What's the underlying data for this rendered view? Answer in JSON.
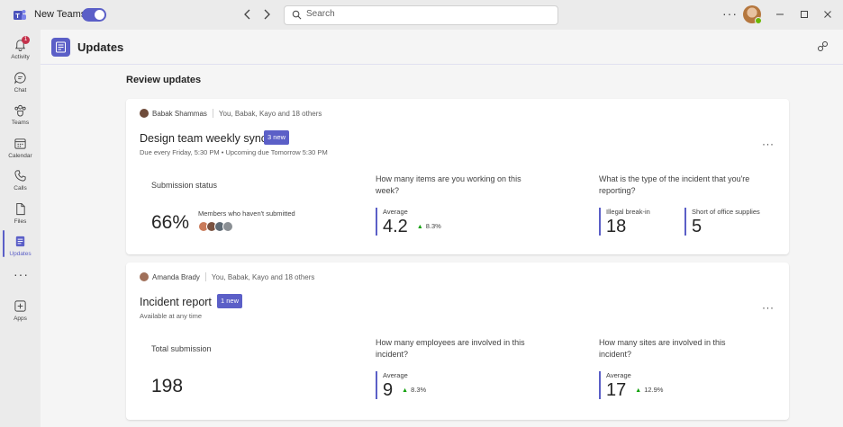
{
  "titlebar": {
    "app_name": "New Teams",
    "search_placeholder": "Search",
    "more": "···"
  },
  "rail": {
    "items": [
      {
        "label": "Activity",
        "badge": "1"
      },
      {
        "label": "Chat"
      },
      {
        "label": "Teams"
      },
      {
        "label": "Calendar"
      },
      {
        "label": "Calls"
      },
      {
        "label": "Files"
      },
      {
        "label": "Updates"
      },
      {
        "label": "Apps"
      }
    ],
    "more": "···"
  },
  "header": {
    "title": "Updates"
  },
  "main": {
    "section_title": "Review updates",
    "cards": [
      {
        "owner": "Babak Shammas",
        "audience": "You, Babak, Kayo and 18 others",
        "title": "Design team weekly sync",
        "badge": "3 new",
        "subtitle": "Due every Friday, 5:30 PM • Upcoming due Tomorrow 5:30 PM",
        "more": "···",
        "metric1": {
          "label": "Submission status",
          "value": "66%",
          "members_label": "Members who haven't submitted"
        },
        "metric2": {
          "question": "How many items are you working on this week?",
          "stat_label": "Average",
          "stat_value": "4.2",
          "trend": "8.3%"
        },
        "metric3": {
          "question": "What is the type of the incident that you're reporting?",
          "stats": [
            {
              "label": "Illegal break-in",
              "value": "18"
            },
            {
              "label": "Short of office supplies",
              "value": "5"
            }
          ]
        }
      },
      {
        "owner": "Amanda Brady",
        "audience": "You, Babak, Kayo and 18 others",
        "title": "Incident report",
        "badge": "1 new",
        "subtitle": "Available at any time",
        "more": "···",
        "metric1": {
          "label": "Total submission",
          "value": "198"
        },
        "metric2": {
          "question": "How many employees are involved in this incident?",
          "stat_label": "Average",
          "stat_value": "9",
          "trend": "8.3%"
        },
        "metric3": {
          "question": "How many sites are involved in this incident?",
          "stat_label": "Average",
          "stat_value": "17",
          "trend": "12.9%"
        }
      }
    ]
  },
  "colors": {
    "accent": "#5b5fc7",
    "trend_up": "#13a10e",
    "notification": "#c4314b"
  }
}
